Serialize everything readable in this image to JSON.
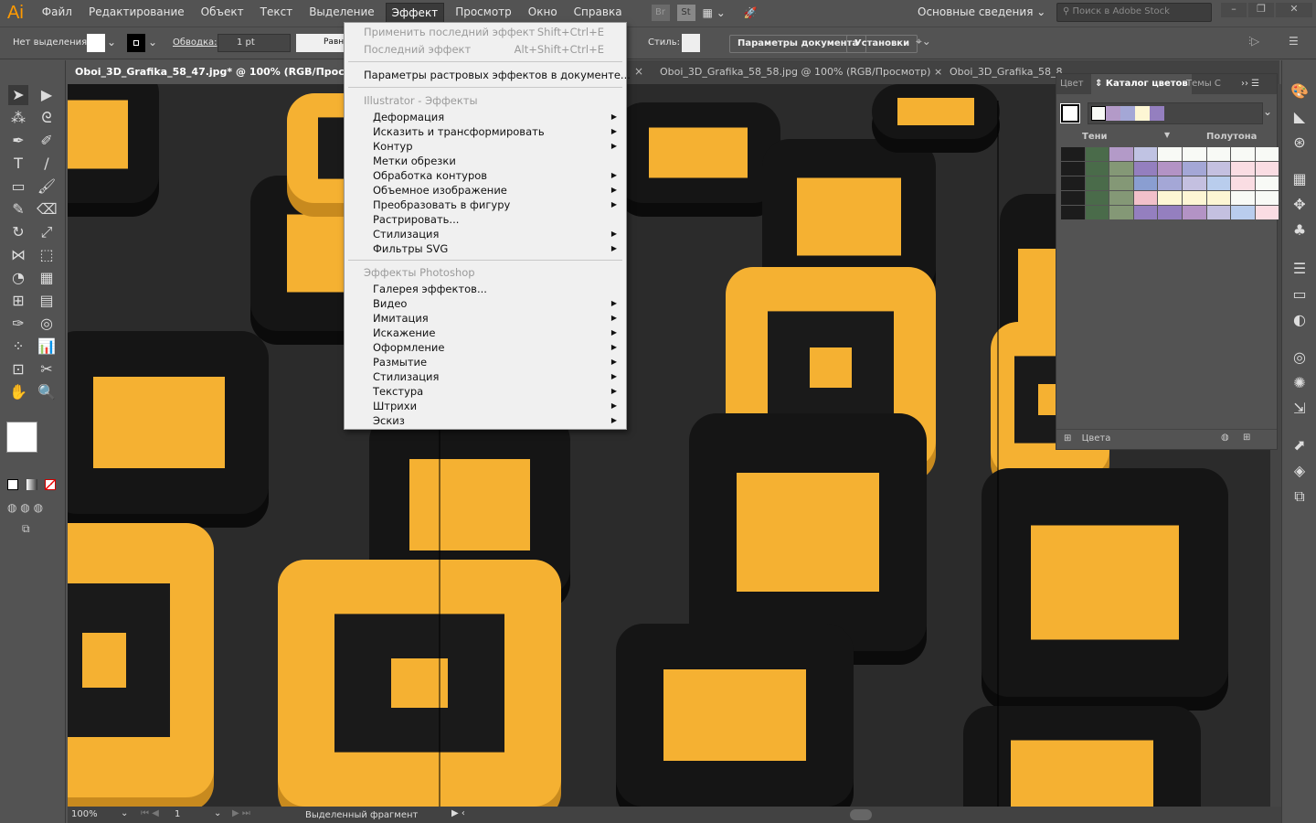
{
  "app": {
    "logo": "Ai",
    "workspace": "Основные сведения",
    "stock_placeholder": "Поиск в Adobe Stock",
    "bridge": "Br",
    "stock": "St"
  },
  "menubar": [
    "Файл",
    "Редактирование",
    "Объект",
    "Текст",
    "Выделение",
    "Эффект",
    "Просмотр",
    "Окно",
    "Справка"
  ],
  "control": {
    "selection": "Нет выделения",
    "stroke_label": "Обводка:",
    "stroke_value": "1 pt",
    "profile": "Равн",
    "style_label": "Стиль:",
    "doc_params": "Параметры документа",
    "prefs": "Установки"
  },
  "tabs": [
    "Oboi_3D_Grafika_58_47.jpg* @ 100% (RGB/Просмотр)",
    "Oboi_3D_Grafika_58_58.jpg @ 100% (RGB/Просмотр)",
    "Oboi_3D_Grafika_58_8"
  ],
  "effect_menu": {
    "apply_last": {
      "label": "Применить последний эффект",
      "shortcut": "Shift+Ctrl+E"
    },
    "last": {
      "label": "Последний эффект",
      "shortcut": "Alt+Shift+Ctrl+E"
    },
    "raster": "Параметры растровых эффектов в документе...",
    "illustrator_header": "Illustrator - Эффекты",
    "illustrator_items": [
      {
        "label": "Деформация",
        "sub": true
      },
      {
        "label": "Исказить и трансформировать",
        "sub": true
      },
      {
        "label": "Контур",
        "sub": true
      },
      {
        "label": "Метки обрезки",
        "sub": false
      },
      {
        "label": "Обработка контуров",
        "sub": true
      },
      {
        "label": "Объемное изображение",
        "sub": true
      },
      {
        "label": "Преобразовать в фигуру",
        "sub": true
      },
      {
        "label": "Растрировать...",
        "sub": false
      },
      {
        "label": "Стилизация",
        "sub": true
      },
      {
        "label": "Фильтры SVG",
        "sub": true
      }
    ],
    "photoshop_header": "Эффекты Photoshop",
    "photoshop_items": [
      {
        "label": "Галерея эффектов...",
        "sub": false
      },
      {
        "label": "Видео",
        "sub": true
      },
      {
        "label": "Имитация",
        "sub": true
      },
      {
        "label": "Искажение",
        "sub": true
      },
      {
        "label": "Оформление",
        "sub": true
      },
      {
        "label": "Размытие",
        "sub": true
      },
      {
        "label": "Стилизация",
        "sub": true
      },
      {
        "label": "Текстура",
        "sub": true
      },
      {
        "label": "Штрихи",
        "sub": true
      },
      {
        "label": "Эскиз",
        "sub": true
      }
    ]
  },
  "panel": {
    "tabs": [
      "Цвет",
      "Каталог цветов",
      "Темы C"
    ],
    "shades_label": "Тени",
    "halftone_label": "Полутона",
    "footer": "Цвета",
    "group_colors": [
      "#f8faf6",
      "#b39ac8",
      "#a4a7d6",
      "#fdf6d4",
      "#947fbf"
    ],
    "swatches": [
      [
        "#1c1c1c",
        "#4a6b4a",
        "#b39ac8",
        "#c0c3e3",
        "#f8faf6",
        "#f8faf6",
        "#f8faf6",
        "#f8faf6",
        "#f8faf6"
      ],
      [
        "#1c1c1c",
        "#4a6b4a",
        "#849876",
        "#947fbf",
        "#b393c5",
        "#a4a7d6",
        "#c4c0e0",
        "#fadde3",
        "#fadde3"
      ],
      [
        "#1c1c1c",
        "#4a6b4a",
        "#849876",
        "#8a9ed1",
        "#a4a7d6",
        "#c4c0e0",
        "#b9cded",
        "#fadde3",
        "#f8faf6"
      ],
      [
        "#1c1c1c",
        "#4a6b4a",
        "#849876",
        "#f2c0ca",
        "#fdf6d4",
        "#fdf6d4",
        "#fdf6d4",
        "#f8faf6",
        "#f8faf6"
      ],
      [
        "#1c1c1c",
        "#4a6b4a",
        "#849876",
        "#947fbf",
        "#947fbf",
        "#b393c5",
        "#c4c0e0",
        "#b9cded",
        "#fadde3"
      ]
    ]
  },
  "status": {
    "zoom": "100%",
    "page": "1",
    "info": "Выделенный фрагмент"
  },
  "colors": {
    "accent": "#ff9a00",
    "tile_yellow": "#f5b132",
    "tile_black": "#151515"
  }
}
